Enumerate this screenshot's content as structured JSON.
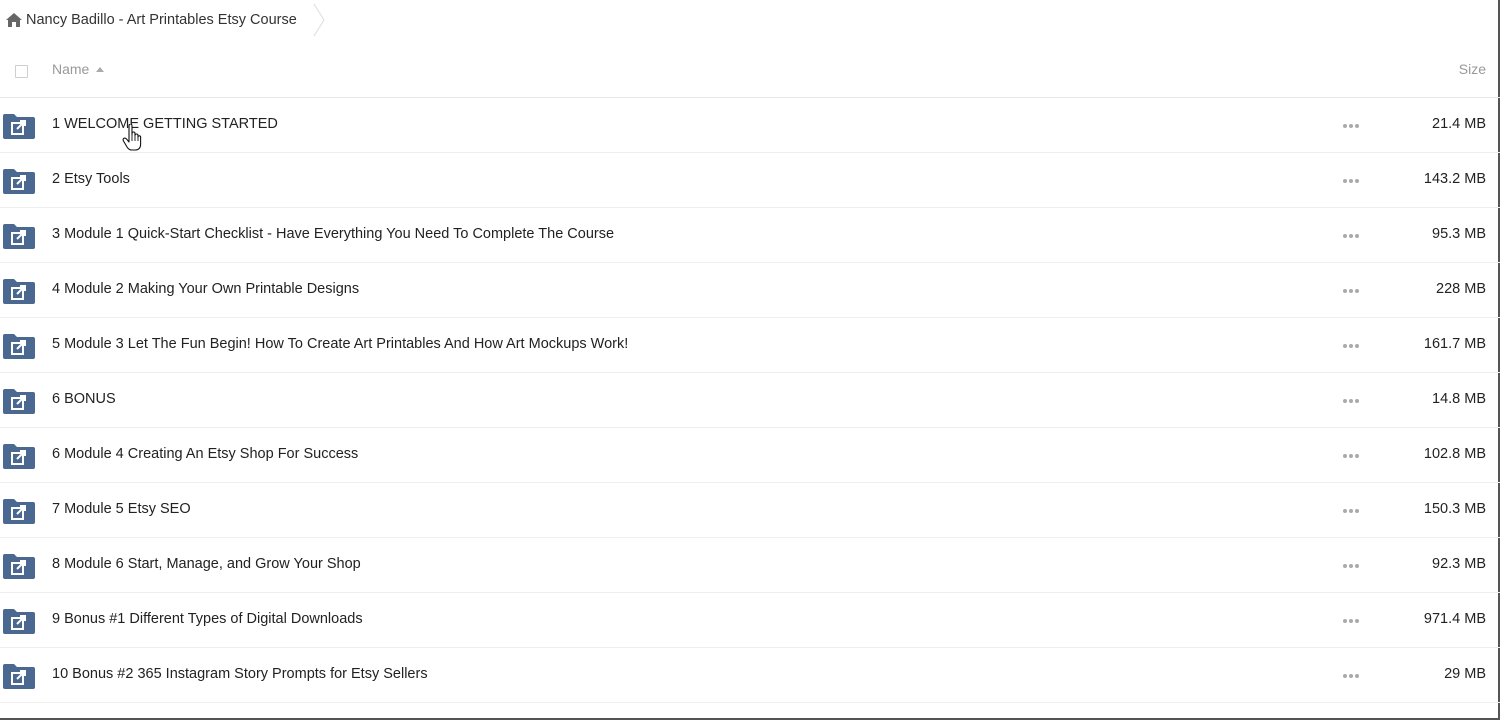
{
  "breadcrumb": {
    "home_icon": "home-icon",
    "label": "Nancy Badillo - Art Printables Etsy Course"
  },
  "header": {
    "name_label": "Name",
    "size_label": "Size",
    "sort_icon": "sort-ascending-icon"
  },
  "colors": {
    "folder": "#4a6890",
    "divider": "#eeeeee",
    "muted_text": "#999999"
  },
  "rows": [
    {
      "name": "1 WELCOME GETTING STARTED",
      "size": "21.4 MB"
    },
    {
      "name": "2 Etsy Tools",
      "size": "143.2 MB"
    },
    {
      "name": "3 Module 1 Quick-Start Checklist - Have Everything You Need To Complete The Course",
      "size": "95.3 MB"
    },
    {
      "name": "4 Module 2 Making Your Own Printable Designs",
      "size": "228 MB"
    },
    {
      "name": "5 Module 3 Let The Fun Begin! How To Create Art Printables And How Art Mockups Work!",
      "size": "161.7 MB"
    },
    {
      "name": "6 BONUS",
      "size": "14.8 MB"
    },
    {
      "name": "6 Module 4 Creating An Etsy Shop For Success",
      "size": "102.8 MB"
    },
    {
      "name": "7 Module 5 Etsy SEO",
      "size": "150.3 MB"
    },
    {
      "name": "8 Module 6 Start, Manage, and Grow Your Shop",
      "size": "92.3 MB"
    },
    {
      "name": "9 Bonus #1 Different Types of Digital Downloads",
      "size": "971.4 MB"
    },
    {
      "name": "10 Bonus #2 365 Instagram Story Prompts for Etsy Sellers",
      "size": "29 MB"
    }
  ]
}
